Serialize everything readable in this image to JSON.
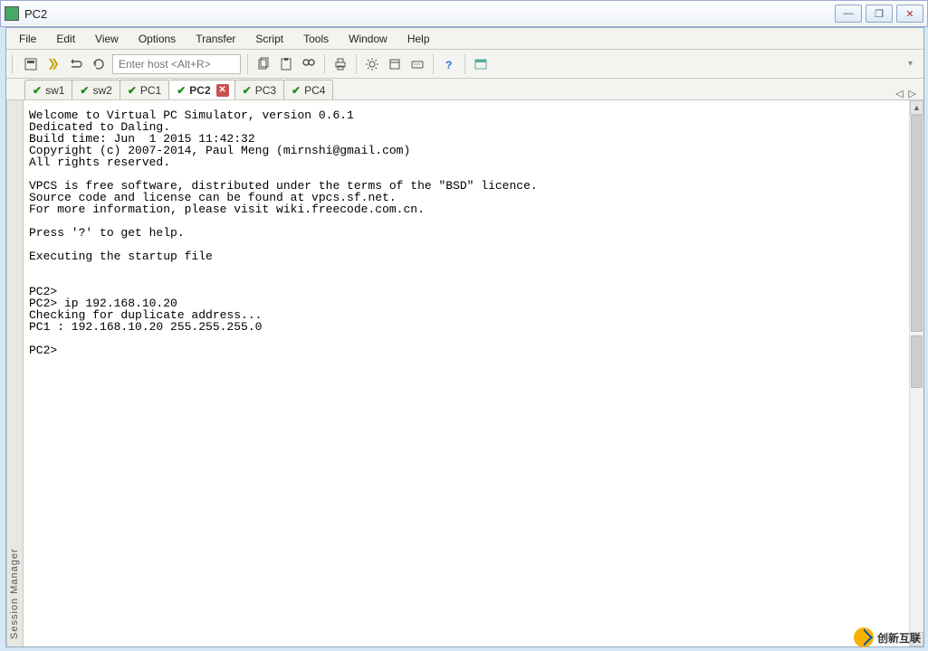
{
  "window": {
    "title": "PC2"
  },
  "menu": {
    "file": "File",
    "edit": "Edit",
    "view": "View",
    "options": "Options",
    "transfer": "Transfer",
    "script": "Script",
    "tools": "Tools",
    "window": "Window",
    "help": "Help"
  },
  "toolbar": {
    "host_placeholder": "Enter host <Alt+R>"
  },
  "sidebar": {
    "label": "Session Manager"
  },
  "tabs": [
    {
      "id": "sw1",
      "label": "sw1",
      "active": false
    },
    {
      "id": "sw2",
      "label": "sw2",
      "active": false
    },
    {
      "id": "pc1",
      "label": "PC1",
      "active": false
    },
    {
      "id": "pc2",
      "label": "PC2",
      "active": true
    },
    {
      "id": "pc3",
      "label": "PC3",
      "active": false
    },
    {
      "id": "pc4",
      "label": "PC4",
      "active": false
    }
  ],
  "terminal": {
    "text": "Welcome to Virtual PC Simulator, version 0.6.1\nDedicated to Daling.\nBuild time: Jun  1 2015 11:42:32\nCopyright (c) 2007-2014, Paul Meng (mirnshi@gmail.com)\nAll rights reserved.\n\nVPCS is free software, distributed under the terms of the \"BSD\" licence.\nSource code and license can be found at vpcs.sf.net.\nFor more information, please visit wiki.freecode.com.cn.\n\nPress '?' to get help.\n\nExecuting the startup file\n\n\nPC2>\nPC2> ip 192.168.10.20\nChecking for duplicate address...\nPC1 : 192.168.10.20 255.255.255.0\n\nPC2>"
  },
  "watermark": {
    "text": "创新互联"
  }
}
